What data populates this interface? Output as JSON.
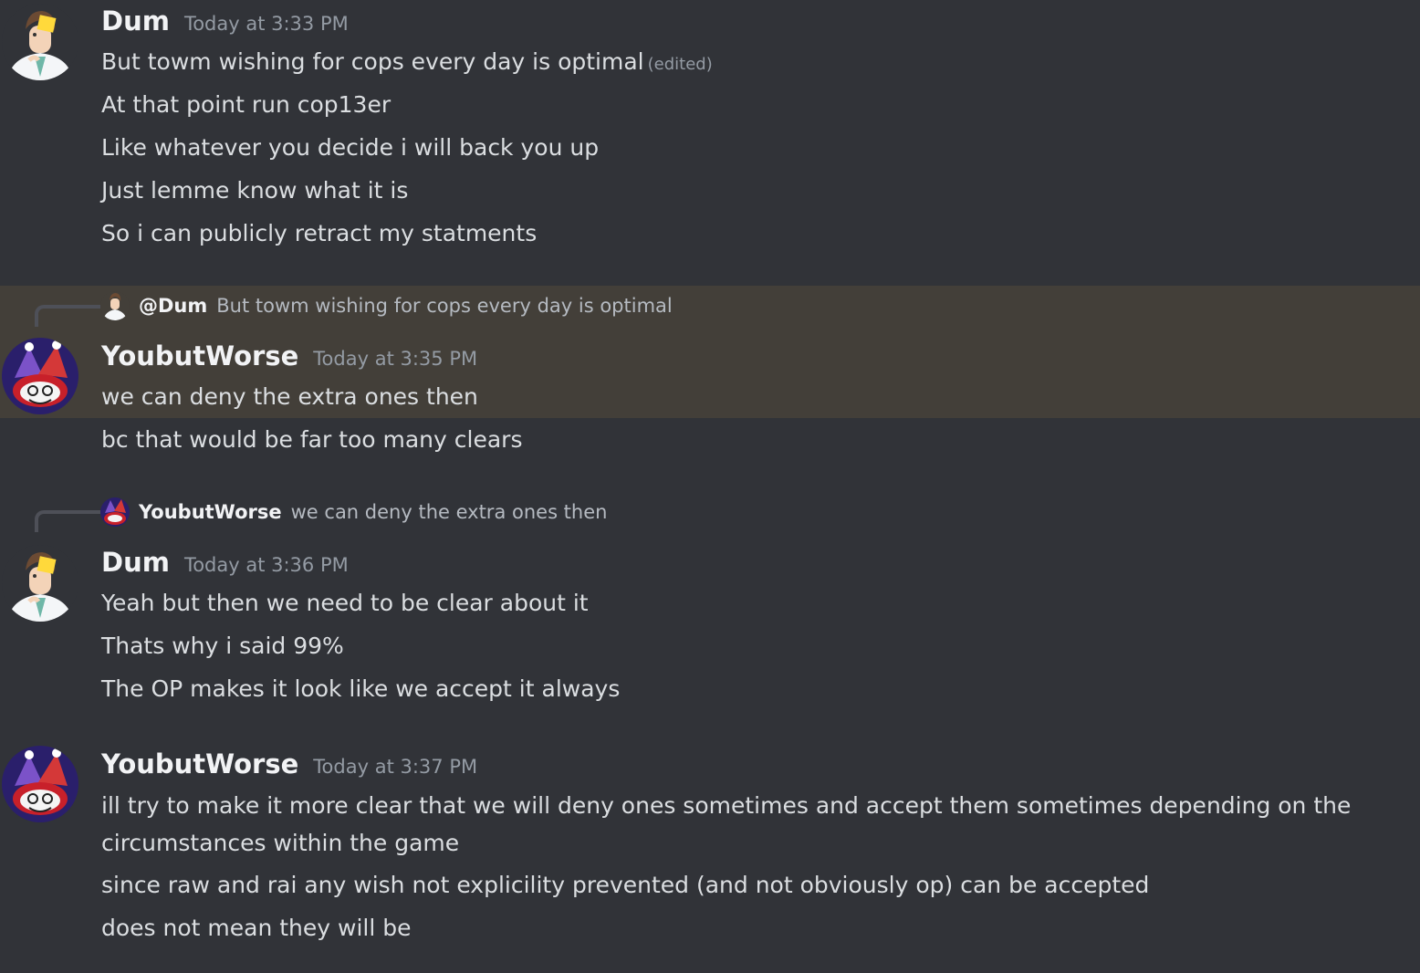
{
  "messages": [
    {
      "author": "Dum",
      "timestamp": "Today at 3:33 PM",
      "avatar_icon": "doctor-avatar-icon",
      "lines": [
        "But towm wishing for cops every day is optimal",
        "At that point run cop13er",
        "Like whatever you decide i will back you up",
        "Just lemme know what it is",
        "So i can publicly retract my statments"
      ],
      "edited_label": "(edited)"
    },
    {
      "author": "YoubutWorse",
      "timestamp": "Today at 3:35 PM",
      "avatar_icon": "jester-avatar-icon",
      "reply": {
        "name": "@Dum",
        "text": "But towm wishing for cops every day is optimal"
      },
      "lines": [
        "we can deny the extra ones then",
        "bc that would be far too many clears"
      ]
    },
    {
      "author": "Dum",
      "timestamp": "Today at 3:36 PM",
      "avatar_icon": "doctor-avatar-icon",
      "reply": {
        "name": "YoubutWorse",
        "text": "we can deny the extra ones then"
      },
      "lines": [
        "Yeah but then we need to be clear about it",
        "Thats why i said 99%",
        "The OP makes it look like we accept it always"
      ]
    },
    {
      "author": "YoubutWorse",
      "timestamp": "Today at 3:37 PM",
      "avatar_icon": "jester-avatar-icon",
      "lines": [
        "ill try to make it more clear that we will deny ones sometimes and accept them sometimes depending on the circumstances within the game",
        "since raw and rai any wish not explicility prevented (and not obviously op) can be accepted",
        "does not mean they will be"
      ]
    }
  ],
  "colors": {
    "background": "#313338",
    "highlight": "#433f39",
    "username": "#f2f3f5",
    "text": "#dbdee1",
    "timestamp": "#949ba4"
  }
}
